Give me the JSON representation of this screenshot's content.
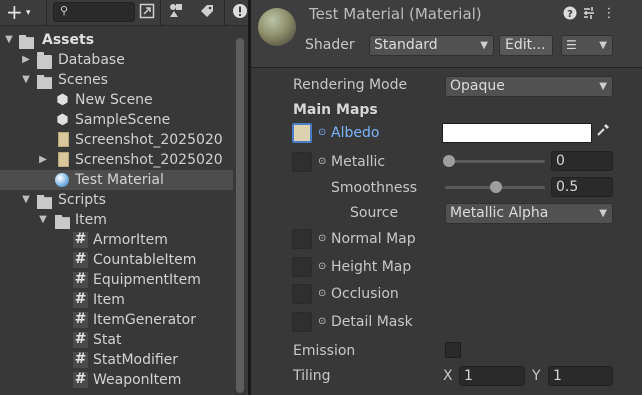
{
  "project": {
    "toolbar": {
      "add_label": "+",
      "add_caret": "▾",
      "search_icon": "search-icon",
      "search_placeholder": ""
    },
    "tree": [
      {
        "label": "Assets",
        "bold": true
      },
      {
        "label": "Database"
      },
      {
        "label": "Scenes"
      },
      {
        "label": "New Scene"
      },
      {
        "label": "SampleScene"
      },
      {
        "label": "Screenshot_2025020"
      },
      {
        "label": "Screenshot_2025020"
      },
      {
        "label": "Test Material",
        "selected": true
      },
      {
        "label": "Scripts"
      },
      {
        "label": "Item"
      },
      {
        "label": "ArmorItem"
      },
      {
        "label": "CountableItem"
      },
      {
        "label": "EquipmentItem"
      },
      {
        "label": "Item"
      },
      {
        "label": "ItemGenerator"
      },
      {
        "label": "Stat"
      },
      {
        "label": "StatModifier"
      },
      {
        "label": "WeaponItem"
      }
    ]
  },
  "inspector": {
    "title": "Test Material (Material)",
    "shader_label": "Shader",
    "shader_value": "Standard",
    "edit_button": "Edit...",
    "rendering_mode_label": "Rendering Mode",
    "rendering_mode_value": "Opaque",
    "main_maps_label": "Main Maps",
    "albedo_label": "Albedo",
    "albedo_color": "#ffffff",
    "metallic_label": "Metallic",
    "metallic_value": "0",
    "metallic_level": 0,
    "smoothness_label": "Smoothness",
    "smoothness_value": "0.5",
    "smoothness_level": 0.5,
    "source_label": "Source",
    "source_value": "Metallic Alpha",
    "normal_map_label": "Normal Map",
    "height_map_label": "Height Map",
    "occlusion_label": "Occlusion",
    "detail_mask_label": "Detail Mask",
    "emission_label": "Emission",
    "emission_checked": false,
    "tiling_label": "Tiling",
    "tiling_x_label": "X",
    "tiling_x": "1",
    "tiling_y_label": "Y",
    "tiling_y": "1"
  },
  "colors": {
    "selection": "#4d4d4d",
    "link_blue": "#7ab4ff",
    "panel_bg": "#383838"
  }
}
